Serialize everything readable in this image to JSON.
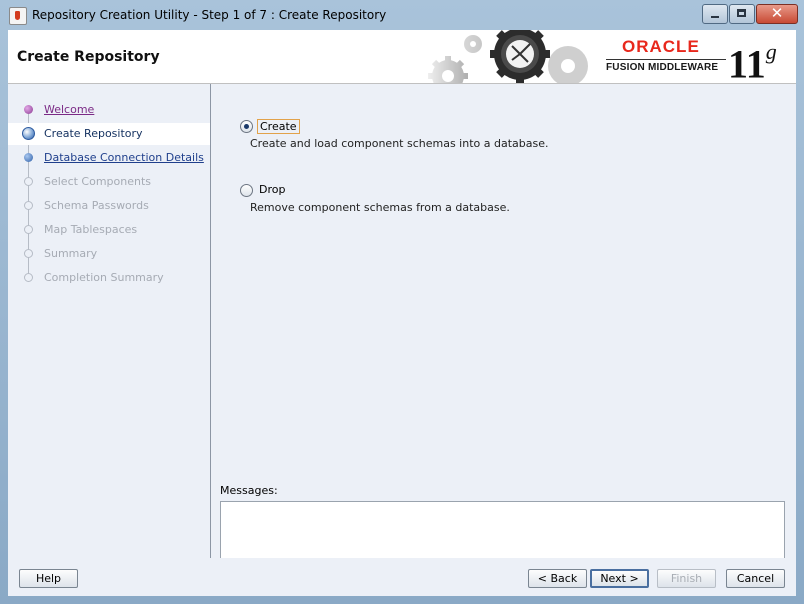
{
  "window": {
    "title": "Repository Creation Utility - Step 1 of 7 : Create Repository",
    "controls": {
      "minimize": "minimize",
      "maximize": "maximize",
      "close": "✕"
    }
  },
  "header": {
    "title": "Create Repository",
    "logo": {
      "brand": "ORACLE",
      "product": "FUSION MIDDLEWARE",
      "version": "11",
      "version_suffix": "g"
    }
  },
  "steps": [
    {
      "label": "Welcome",
      "state": "visited"
    },
    {
      "label": "Create Repository",
      "state": "current"
    },
    {
      "label": "Database Connection Details",
      "state": "next"
    },
    {
      "label": "Select Components",
      "state": "pending"
    },
    {
      "label": "Schema Passwords",
      "state": "pending"
    },
    {
      "label": "Map Tablespaces",
      "state": "pending"
    },
    {
      "label": "Summary",
      "state": "pending"
    },
    {
      "label": "Completion Summary",
      "state": "pending"
    }
  ],
  "options": {
    "create": {
      "label": "Create",
      "description": "Create and load component schemas into a database.",
      "selected": true
    },
    "drop": {
      "label": "Drop",
      "description": "Remove component schemas from a database.",
      "selected": false
    }
  },
  "messages": {
    "label": "Messages:",
    "value": ""
  },
  "buttons": {
    "help": "Help",
    "back": "< Back",
    "next": "Next >",
    "finish": "Finish",
    "cancel": "Cancel"
  },
  "colors": {
    "oracle_red": "#e8281c",
    "visited_link": "#7b2a86",
    "link": "#1f3f8c",
    "disabled": "#a6abb4"
  }
}
